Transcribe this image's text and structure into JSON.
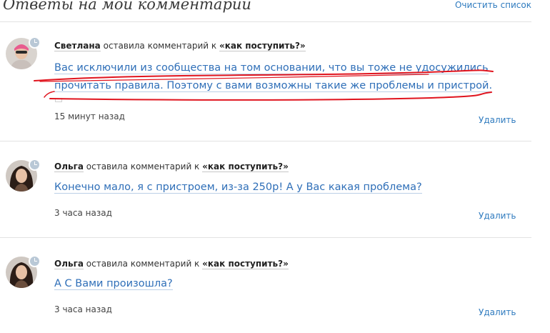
{
  "header": {
    "title": "Ответы на мои комментарии",
    "clear_label": "Очистить список"
  },
  "comments": [
    {
      "author": "Светлана",
      "action": " оставила комментарий к ",
      "post": "«как поступить?»",
      "text_lines": [
        "Вас исключили из сообщества на том основании, что вы тоже не удосужились",
        "прочитать правила. Поэтому с вами возможны такие же проблемы и пристрой."
      ],
      "time": "15 минут назад",
      "delete_label": "Удалить",
      "avatar_icon": "user-photo-icon",
      "highlighted": true
    },
    {
      "author": "Ольга",
      "action": " оставила комментарий к ",
      "post": "«как поступить?»",
      "text_lines": [
        "Конечно мало, я с пристроем, из-за 250р! А у Вас какая проблема?"
      ],
      "time": "3 часа назад",
      "delete_label": "Удалить",
      "avatar_icon": "user-photo-icon"
    },
    {
      "author": "Ольга",
      "action": " оставила комментарий к ",
      "post": "«как поступить?»",
      "text_lines": [
        "А С Вами произошла?"
      ],
      "time": "3 часа назад",
      "delete_label": "Удалить",
      "avatar_icon": "user-photo-icon"
    }
  ],
  "colors": {
    "link": "#2f7bbf",
    "comment_text": "#2f6fb8",
    "annotation_underline": "#e0141e"
  }
}
